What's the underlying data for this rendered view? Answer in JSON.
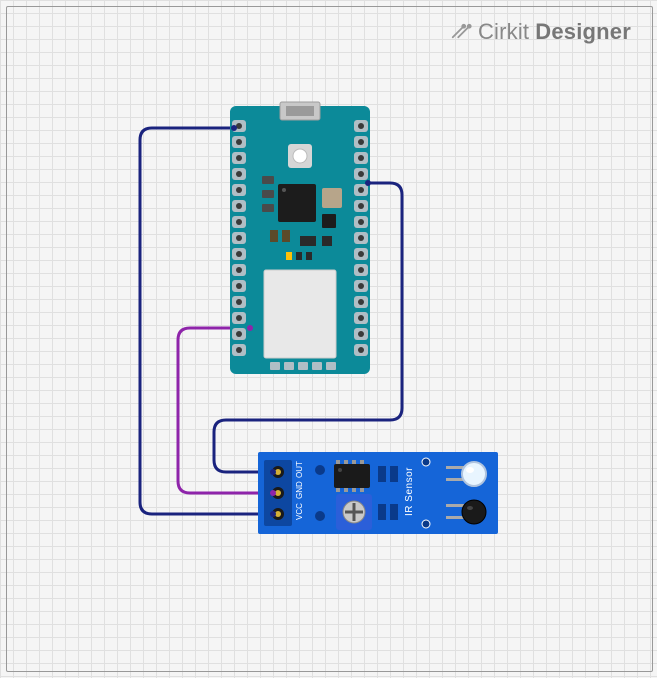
{
  "brand": {
    "name": "Cirkit",
    "suffix": "Designer"
  },
  "board": {
    "name": "Arduino Nano 33 BLE"
  },
  "sensor": {
    "name": "IR Sensor",
    "pins": [
      "OUT",
      "GND",
      "VCC"
    ]
  },
  "wires": [
    {
      "name": "wire-out",
      "color": "#1a237e",
      "from": "sensor.OUT",
      "to": "board.digital"
    },
    {
      "name": "wire-gnd",
      "color": "#8e24aa",
      "from": "sensor.GND",
      "to": "board.gnd"
    },
    {
      "name": "wire-vcc",
      "color": "#1a237e",
      "from": "sensor.VCC",
      "to": "board.vcc"
    }
  ]
}
